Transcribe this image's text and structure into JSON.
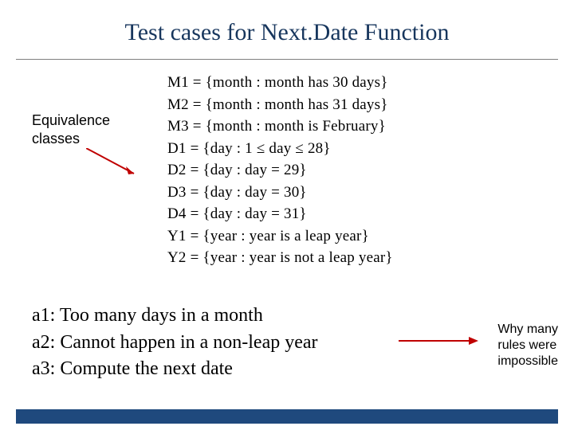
{
  "title": "Test cases for Next.Date Function",
  "equiv_label_line1": "Equivalence",
  "equiv_label_line2": "classes",
  "classes": {
    "m1": "M1 = {month : month has 30 days}",
    "m2": "M2 = {month : month has 31 days}",
    "m3": "M3 = {month : month is February}",
    "d1": "D1 = {day : 1 ≤ day ≤ 28}",
    "d2": "D2 = {day : day = 29}",
    "d3": "D3 = {day : day = 30}",
    "d4": "D4 = {day : day = 31}",
    "y1": "Y1 = {year : year is a leap year}",
    "y2": "Y2 = {year : year is not a leap year}"
  },
  "actions": {
    "a1": "a1: Too many days in a month",
    "a2": "a2: Cannot happen in a non-leap year",
    "a3": "a3: Compute the next date"
  },
  "why": {
    "line1": "Why many",
    "line2": "rules were",
    "line3": "impossible"
  }
}
